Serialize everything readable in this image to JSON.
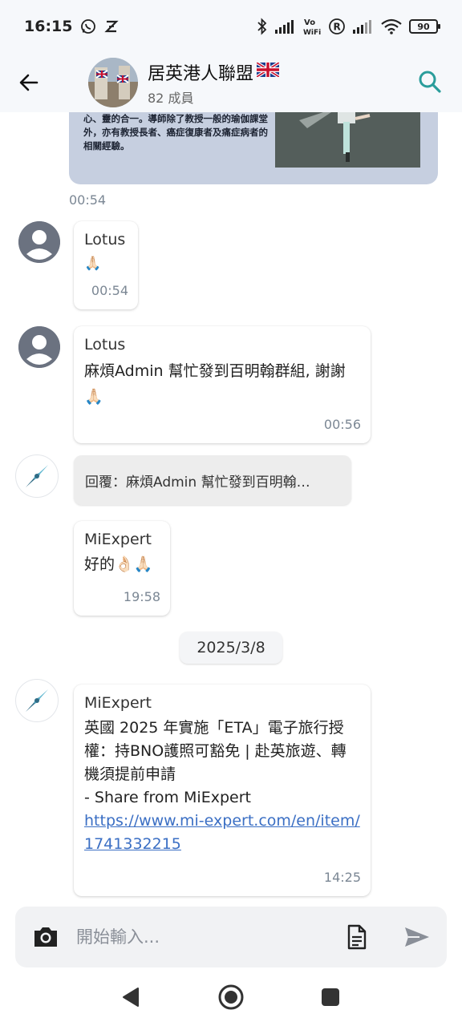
{
  "status_bar": {
    "time": "16:15",
    "icons": [
      "whatsapp-icon",
      "z-app-icon",
      "bluetooth-icon",
      "signal-icon",
      "vowifi-icon",
      "r-icon",
      "signal-icon",
      "wifi-icon"
    ],
    "battery": "90"
  },
  "header": {
    "title": "居英港人聯盟",
    "flag": "🇬🇧",
    "subtitle": "82 成員"
  },
  "image_message": {
    "caption": "來強身健體，預防及治療病痛，並達致身、心、靈的合一。導師除了教授一般的瑜伽課堂外，亦有教授長者、癌症復康者及痛症病者的相關經驗。",
    "time": "00:54"
  },
  "messages": [
    {
      "sender": "Lotus",
      "text": "🙏🏻",
      "time": "00:54"
    },
    {
      "sender": "Lotus",
      "text": "麻煩Admin 幫忙發到百明翰群組, 謝謝🙏🏻",
      "time": "00:56"
    }
  ],
  "reply": {
    "text": "回覆：麻煩Admin 幫忙發到百明翰…"
  },
  "reply_message": {
    "sender": "MiExpert",
    "text": "好的👌🏻🙏🏻",
    "time": "19:58"
  },
  "date_divider": "2025/3/8",
  "share_message": {
    "sender": "MiExpert",
    "text": "英國 2025 年實施「ETA」電子旅行授權：持BNO護照可豁免 | 赴英旅遊、轉機須提前申請",
    "share_line": "- Share from MiExpert",
    "link": "https://www.mi-expert.com/en/item/1741332215",
    "time": "14:25"
  },
  "composer": {
    "placeholder": "開始輸入..."
  },
  "colors": {
    "accent": "#2a9d9b",
    "header_bg": "#f6f8fb",
    "link": "#3b6fc4"
  }
}
